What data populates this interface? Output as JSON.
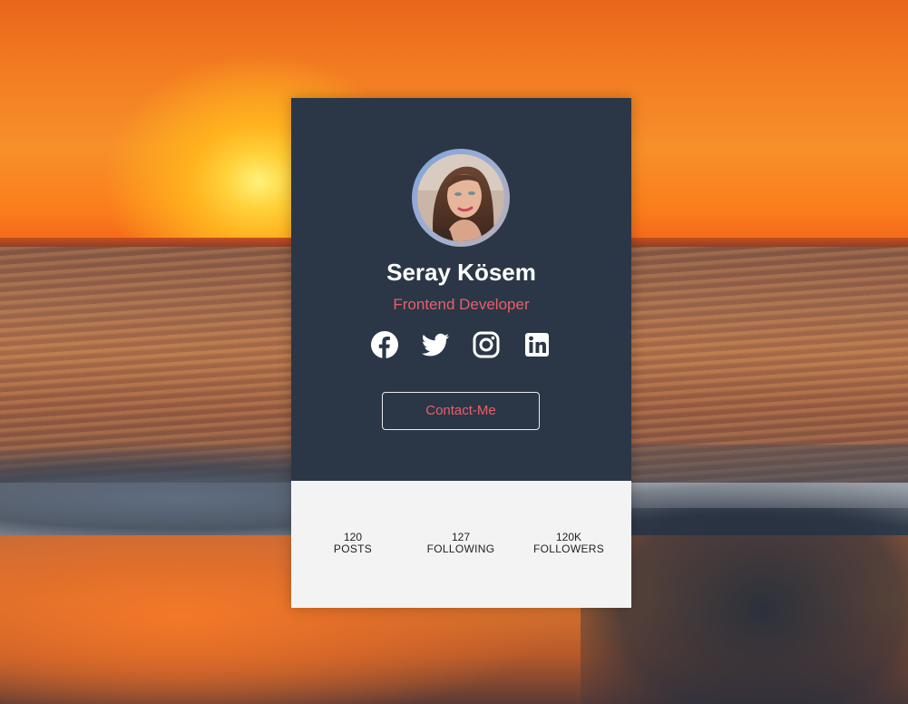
{
  "profile": {
    "name": "Seray Kösem",
    "role": "Frontend Developer",
    "contact_label": "Contact-Me"
  },
  "socials": [
    {
      "icon": "facebook-icon"
    },
    {
      "icon": "twitter-icon"
    },
    {
      "icon": "instagram-icon"
    },
    {
      "icon": "linkedin-icon"
    }
  ],
  "stats": [
    {
      "value": "120",
      "label": "POSTS"
    },
    {
      "value": "127",
      "label": "FOLLOWING"
    },
    {
      "value": "120K",
      "label": "FOLLOWERS"
    }
  ],
  "colors": {
    "card_dark": "#2b3746",
    "accent": "#ea5e6b",
    "stats_bg": "#f3f3f3"
  }
}
